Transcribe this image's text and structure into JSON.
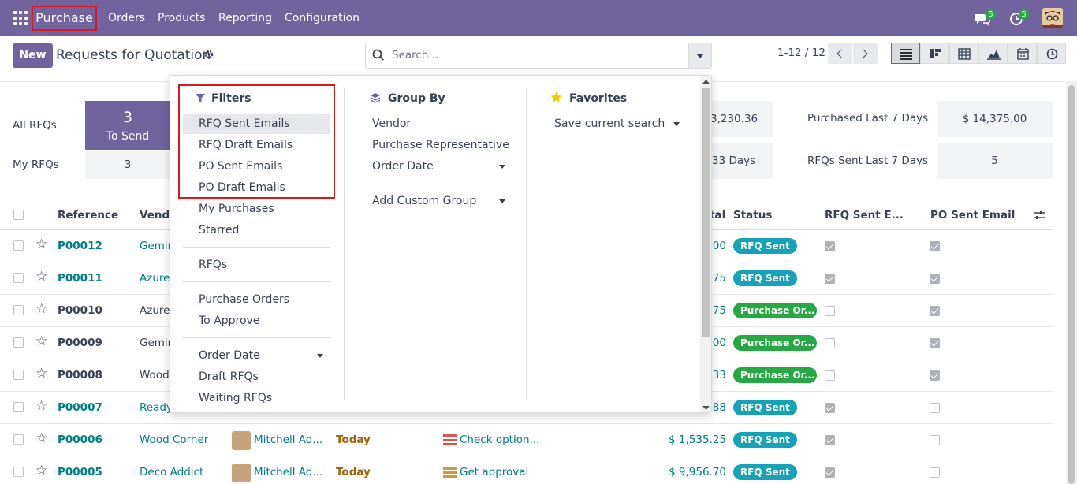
{
  "navbar": {
    "app_name": "Purchase",
    "menu": [
      "Orders",
      "Products",
      "Reporting",
      "Configuration"
    ],
    "messages_badge": "5",
    "activities_badge": "5",
    "color": "#71639e"
  },
  "control_panel": {
    "new_label": "New",
    "title": "Requests for Quotation",
    "search_placeholder": "Search...",
    "pager": "1-12 / 12",
    "views": [
      "list-view-icon",
      "kanban-view-icon",
      "pivot-view-icon",
      "graph-view-icon",
      "calendar-view-icon",
      "activity-view-icon"
    ]
  },
  "dashboard": {
    "all_rfqs_label": "All RFQs",
    "my_rfqs_label": "My RFQs",
    "to_send_count": "3",
    "to_send_label": "To Send",
    "my_to_send": "3",
    "partial_value_1": "3,230.36",
    "partial_value_2": "33 Days",
    "purchased_last_7_label": "Purchased Last 7 Days",
    "purchased_last_7_value": "$ 14,375.00",
    "rfqs_sent_last_7_label": "RFQs Sent Last 7 Days",
    "rfqs_sent_last_7_value": "5"
  },
  "table": {
    "headers": {
      "reference": "Reference",
      "vendor": "Vendo",
      "total": "tal",
      "status": "Status",
      "rfq_sent": "RFQ Sent E...",
      "po_sent": "PO Sent Email"
    },
    "rows": [
      {
        "ref": "P00012",
        "ref_link": true,
        "vendor": "Gemin",
        "vendor_link": true,
        "buyer": "",
        "date": "",
        "activity": "",
        "total": ".00",
        "status": "RFQ Sent",
        "status_color": "blue",
        "rfq_sent": true,
        "po_sent": true
      },
      {
        "ref": "P00011",
        "ref_link": true,
        "vendor": "Azure",
        "vendor_link": true,
        "buyer": "",
        "date": "",
        "activity": "",
        "total": ".75",
        "status": "RFQ Sent",
        "status_color": "blue",
        "rfq_sent": true,
        "po_sent": true
      },
      {
        "ref": "P00010",
        "ref_link": false,
        "vendor": "Azure",
        "vendor_link": false,
        "buyer": "",
        "date": "",
        "activity": "",
        "total": ".75",
        "status": "Purchase Or...",
        "status_color": "green",
        "rfq_sent": false,
        "po_sent": true
      },
      {
        "ref": "P00009",
        "ref_link": false,
        "vendor": "Gemin",
        "vendor_link": false,
        "buyer": "",
        "date": "",
        "activity": "",
        "total": ".00",
        "status": "Purchase Or...",
        "status_color": "green",
        "rfq_sent": false,
        "po_sent": true
      },
      {
        "ref": "P00008",
        "ref_link": false,
        "vendor": "Wood",
        "vendor_link": false,
        "buyer": "",
        "date": "",
        "activity": "",
        "total": ".33",
        "status": "Purchase Or...",
        "status_color": "green",
        "rfq_sent": false,
        "po_sent": true
      },
      {
        "ref": "P00007",
        "ref_link": true,
        "vendor": "Ready",
        "vendor_link": true,
        "buyer": "",
        "date": "",
        "activity": "",
        "total": ".88",
        "status": "RFQ Sent",
        "status_color": "blue",
        "rfq_sent": true,
        "po_sent": false
      },
      {
        "ref": "P00006",
        "ref_link": true,
        "vendor": "Wood Corner",
        "vendor_link": true,
        "buyer": "Mitchell Ad...",
        "date": "Today",
        "activity": "Check option...",
        "total": "$ 1,535.25",
        "status": "RFQ Sent",
        "status_color": "blue",
        "rfq_sent": true,
        "po_sent": false
      },
      {
        "ref": "P00005",
        "ref_link": true,
        "vendor": "Deco Addict",
        "vendor_link": true,
        "buyer": "Mitchell Ad...",
        "date": "Today",
        "activity": "Get approval",
        "total": "$ 9,956.70",
        "status": "RFQ Sent",
        "status_color": "blue",
        "rfq_sent": true,
        "po_sent": false
      }
    ]
  },
  "search_panel": {
    "filters_title": "Filters",
    "filters": [
      "RFQ Sent Emails",
      "RFQ Draft Emails",
      "PO Sent Emails",
      "PO Draft Emails",
      "My Purchases",
      "Starred",
      "RFQs",
      "Purchase Orders",
      "To Approve",
      "Order Date",
      "Draft RFQs",
      "Waiting RFQs"
    ],
    "group_by_title": "Group By",
    "group_by": [
      "Vendor",
      "Purchase Representative",
      "Order Date",
      "Add Custom Group"
    ],
    "favorites_title": "Favorites",
    "favorites": [
      "Save current search"
    ]
  }
}
